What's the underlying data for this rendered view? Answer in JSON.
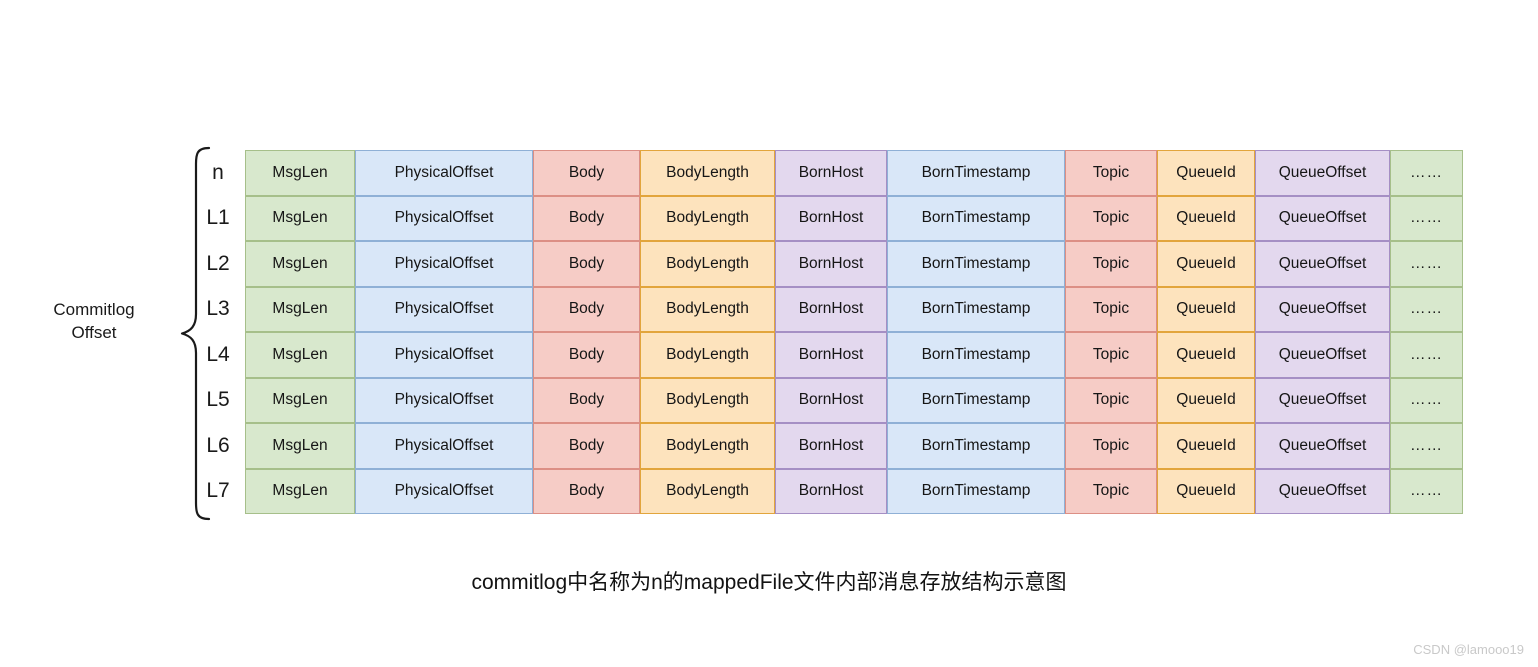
{
  "diagram": {
    "caption": "commitlog中名称为n的mappedFile文件内部消息存放结构示意图",
    "brace_label": "Commitlog\nOffset",
    "row_labels": [
      "n",
      "L1",
      "L2",
      "L3",
      "L4",
      "L5",
      "L6",
      "L7"
    ],
    "columns": [
      {
        "name": "MsgLen",
        "label": "MsgLen",
        "color": "#d8e8cd",
        "border": "#a6bf8a",
        "theme": "t-green"
      },
      {
        "name": "PhysicalOffset",
        "label": "PhysicalOffset",
        "color": "#d9e7f8",
        "border": "#8fb0d6",
        "theme": "t-blue"
      },
      {
        "name": "Body",
        "label": "Body",
        "color": "#f6ccc6",
        "border": "#dc8f85",
        "theme": "t-red"
      },
      {
        "name": "BodyLength",
        "label": "BodyLength",
        "color": "#fde3bd",
        "border": "#e2a53c",
        "theme": "t-orange"
      },
      {
        "name": "BornHost",
        "label": "BornHost",
        "color": "#e3d8ee",
        "border": "#a58fc4",
        "theme": "t-purple"
      },
      {
        "name": "BornTimestamp",
        "label": "BornTimestamp",
        "color": "#d9e7f8",
        "border": "#8fb0d6",
        "theme": "t-blue"
      },
      {
        "name": "Topic",
        "label": "Topic",
        "color": "#f6ccc6",
        "border": "#dc8f85",
        "theme": "t-red"
      },
      {
        "name": "QueueId",
        "label": "QueueId",
        "color": "#fde3bd",
        "border": "#e2a53c",
        "theme": "t-orange"
      },
      {
        "name": "QueueOffset",
        "label": "QueueOffset",
        "color": "#e3d8ee",
        "border": "#a58fc4",
        "theme": "t-purple"
      },
      {
        "name": "ellipsis",
        "label": "……",
        "color": "#d8e8cd",
        "border": "#a6bf8a",
        "theme": "t-green"
      }
    ],
    "rows": [
      [
        "MsgLen",
        "PhysicalOffset",
        "Body",
        "BodyLength",
        "BornHost",
        "BornTimestamp",
        "Topic",
        "QueueId",
        "QueueOffset",
        "……"
      ],
      [
        "MsgLen",
        "PhysicalOffset",
        "Body",
        "BodyLength",
        "BornHost",
        "BornTimestamp",
        "Topic",
        "QueueId",
        "QueueOffset",
        "……"
      ],
      [
        "MsgLen",
        "PhysicalOffset",
        "Body",
        "BodyLength",
        "BornHost",
        "BornTimestamp",
        "Topic",
        "QueueId",
        "QueueOffset",
        "……"
      ],
      [
        "MsgLen",
        "PhysicalOffset",
        "Body",
        "BodyLength",
        "BornHost",
        "BornTimestamp",
        "Topic",
        "QueueId",
        "QueueOffset",
        "……"
      ],
      [
        "MsgLen",
        "PhysicalOffset",
        "Body",
        "BodyLength",
        "BornHost",
        "BornTimestamp",
        "Topic",
        "QueueId",
        "QueueOffset",
        "……"
      ],
      [
        "MsgLen",
        "PhysicalOffset",
        "Body",
        "BodyLength",
        "BornHost",
        "BornTimestamp",
        "Topic",
        "QueueId",
        "QueueOffset",
        "……"
      ],
      [
        "MsgLen",
        "PhysicalOffset",
        "Body",
        "BodyLength",
        "BornHost",
        "BornTimestamp",
        "Topic",
        "QueueId",
        "QueueOffset",
        "……"
      ],
      [
        "MsgLen",
        "PhysicalOffset",
        "Body",
        "BodyLength",
        "BornHost",
        "BornTimestamp",
        "Topic",
        "QueueId",
        "QueueOffset",
        "……"
      ]
    ]
  },
  "watermark": "CSDN @lamooo19"
}
